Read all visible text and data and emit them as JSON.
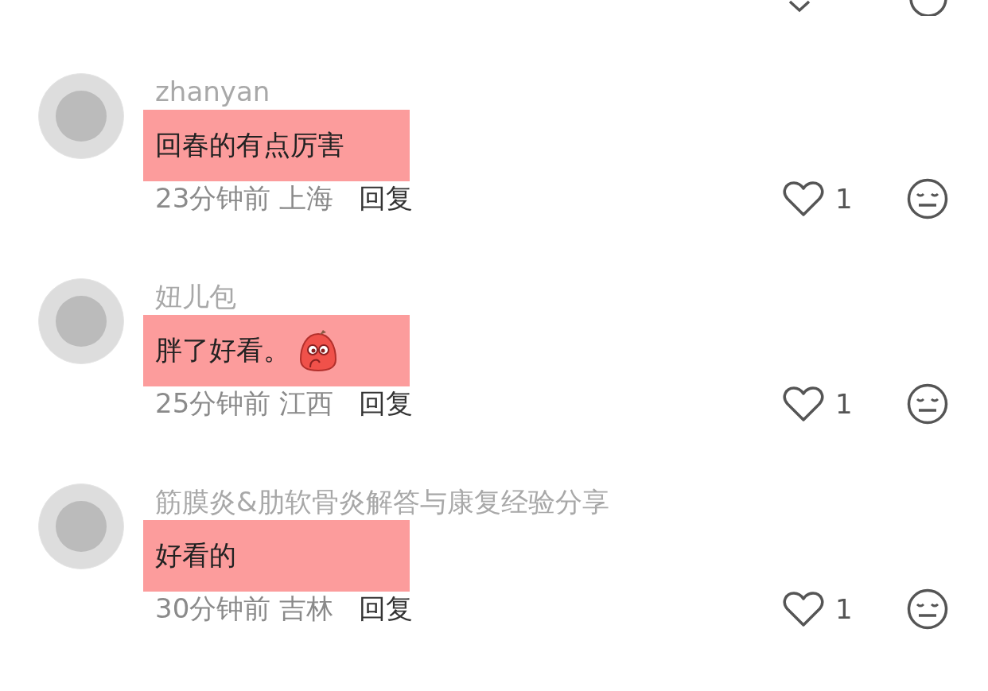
{
  "comments": [
    {
      "username": "zhanyan",
      "text": "回春的有点厉害",
      "sticker": false,
      "highlighted": true,
      "time": "23分钟前",
      "location": "上海",
      "reply": "回复",
      "likes": "1"
    },
    {
      "username": "妞儿包",
      "text": "胖了好看。",
      "sticker": true,
      "highlighted": true,
      "time": "25分钟前",
      "location": "江西",
      "reply": "回复",
      "likes": "1"
    },
    {
      "username": "筋膜炎&肋软骨炎解答与康复经验分享",
      "text": "好看的",
      "sticker": false,
      "highlighted": true,
      "time": "30分钟前",
      "location": "吉林",
      "reply": "回复",
      "likes": "1"
    }
  ]
}
